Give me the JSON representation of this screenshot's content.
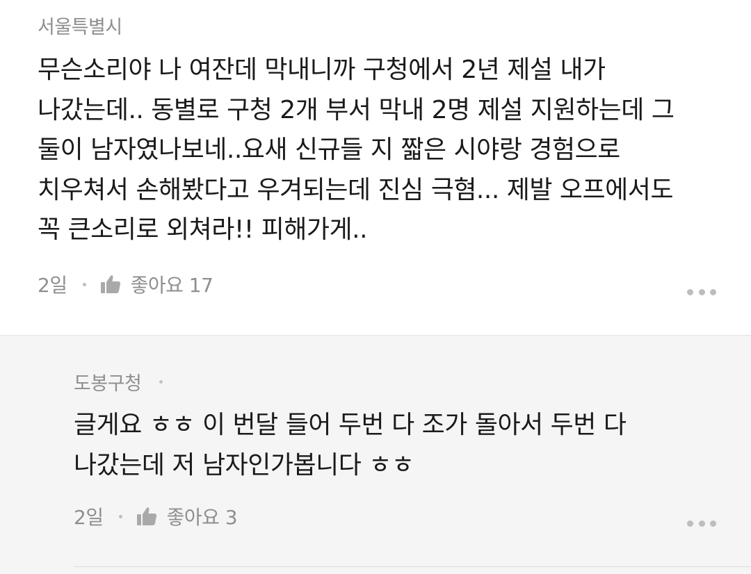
{
  "comment": {
    "author": "서울특별시",
    "lines": [
      "무슨소리야 나 여잔데 막내니까 구청에서 2년 제설 내가",
      "나갔는데.. 동별로 구청 2개 부서 막내 2명 제설 지원하는데 그",
      "둘이 남자였나보네..요새 신규들 지 짧은 시야랑 경험으로",
      "치우쳐서 손해봤다고 우겨되는데 진심 극혐... 제발 오프에서도",
      "꼭 큰소리로 외쳐라!! 피해가게.."
    ],
    "date": "2일",
    "like_label": "좋아요 17",
    "icons": {
      "like": "thumbs-up-icon",
      "more": "more-icon"
    }
  },
  "reply": {
    "author": "도봉구청",
    "lines": [
      "글게요 ㅎㅎ 이 번달 들어 두번 다 조가 돌아서 두번 다",
      "나갔는데 저 남자인가봅니다 ㅎㅎ"
    ],
    "date": "2일",
    "like_label": "좋아요 3",
    "icons": {
      "like": "thumbs-up-icon",
      "more": "more-icon"
    }
  },
  "colors": {
    "text_primary": "#1a1a1a",
    "text_secondary": "#8e8e8e",
    "reply_background": "#f5f5f5"
  }
}
